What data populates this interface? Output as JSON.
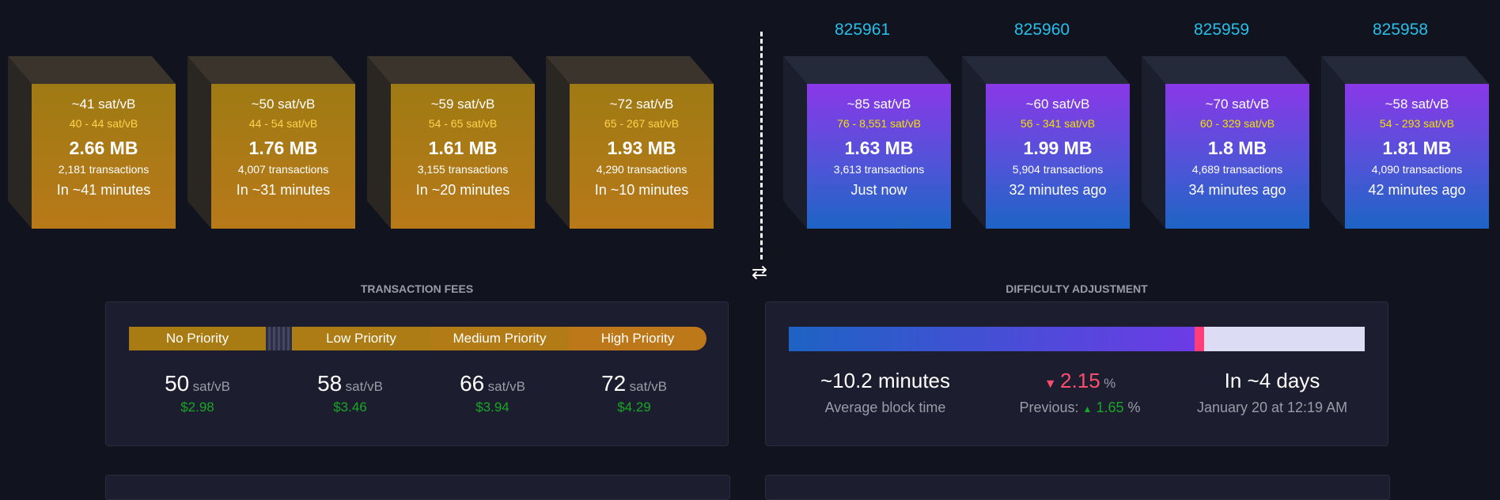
{
  "mempool_blocks": [
    {
      "median": "~41 sat/vB",
      "range": "40 - 44 sat/vB",
      "size": "2.66 MB",
      "tx": "2,181 transactions",
      "time": "In ~41 minutes"
    },
    {
      "median": "~50 sat/vB",
      "range": "44 - 54 sat/vB",
      "size": "1.76 MB",
      "tx": "4,007 transactions",
      "time": "In ~31 minutes"
    },
    {
      "median": "~59 sat/vB",
      "range": "54 - 65 sat/vB",
      "size": "1.61 MB",
      "tx": "3,155 transactions",
      "time": "In ~20 minutes"
    },
    {
      "median": "~72 sat/vB",
      "range": "65 - 267 sat/vB",
      "size": "1.93 MB",
      "tx": "4,290 transactions",
      "time": "In ~10 minutes"
    }
  ],
  "mined_blocks": [
    {
      "height": "825961",
      "median": "~85 sat/vB",
      "range": "76 - 8,551 sat/vB",
      "size": "1.63 MB",
      "tx": "3,613 transactions",
      "time": "Just now"
    },
    {
      "height": "825960",
      "median": "~60 sat/vB",
      "range": "56 - 341 sat/vB",
      "size": "1.99 MB",
      "tx": "5,904 transactions",
      "time": "32 minutes ago"
    },
    {
      "height": "825959",
      "median": "~70 sat/vB",
      "range": "60 - 329 sat/vB",
      "size": "1.8 MB",
      "tx": "4,689 transactions",
      "time": "34 minutes ago"
    },
    {
      "height": "825958",
      "median": "~58 sat/vB",
      "range": "54 - 293 sat/vB",
      "size": "1.81 MB",
      "tx": "4,090 transactions",
      "time": "42 minutes ago"
    }
  ],
  "swap_icon": "⇄",
  "fees": {
    "title": "TRANSACTION FEES",
    "priorities": [
      "No Priority",
      "Low Priority",
      "Medium Priority",
      "High Priority"
    ],
    "values": [
      {
        "value": "50",
        "unit": "sat/vB",
        "usd": "$2.98"
      },
      {
        "value": "58",
        "unit": "sat/vB",
        "usd": "$3.46"
      },
      {
        "value": "66",
        "unit": "sat/vB",
        "usd": "$3.94"
      },
      {
        "value": "72",
        "unit": "sat/vB",
        "usd": "$4.29"
      }
    ]
  },
  "difficulty": {
    "title": "DIFFICULTY ADJUSTMENT",
    "progress_fraction": 0.71,
    "block_time": "~10.2 minutes",
    "block_time_label": "Average block time",
    "change": "2.15",
    "change_unit": "%",
    "previous_label": "Previous:",
    "previous": "1.65",
    "previous_unit": "%",
    "eta": "In ~4 days",
    "eta_date": "January 20 at 12:19 AM"
  },
  "colors": {
    "accent": "#27bfe8",
    "usd": "#19a626",
    "down": "#ff4d6d",
    "up": "#19a626"
  }
}
